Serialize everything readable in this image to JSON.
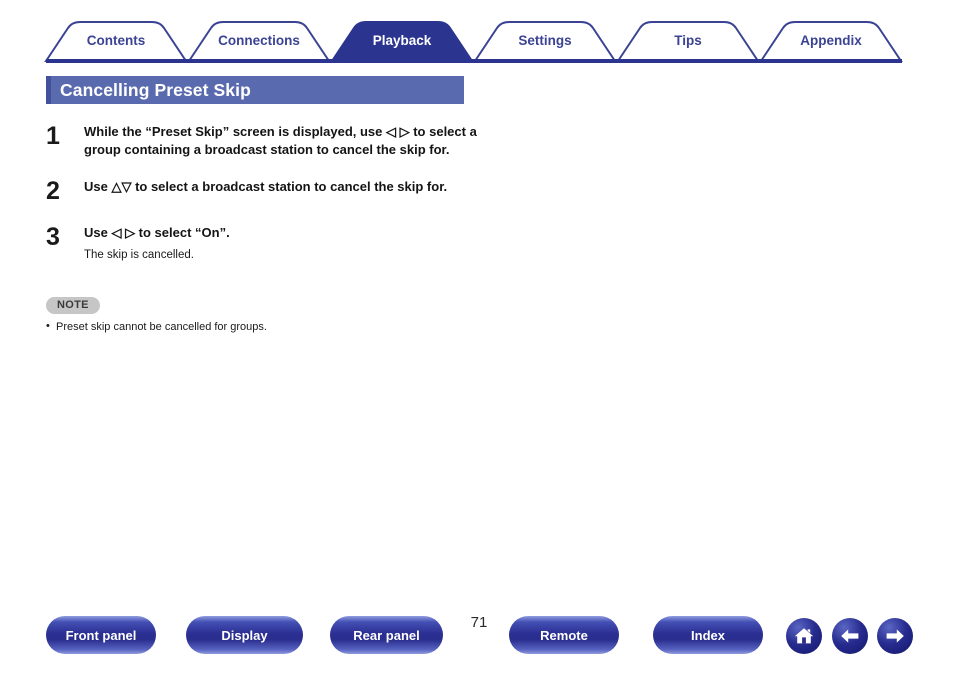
{
  "nav": {
    "tabs": [
      {
        "label": "Contents",
        "active": false
      },
      {
        "label": "Connections",
        "active": false
      },
      {
        "label": "Playback",
        "active": true
      },
      {
        "label": "Settings",
        "active": false
      },
      {
        "label": "Tips",
        "active": false
      },
      {
        "label": "Appendix",
        "active": false
      }
    ],
    "active_tab": "Playback",
    "accent_color": "#3b4394",
    "active_fill": "#2b3590"
  },
  "page": {
    "title": "Cancelling Preset Skip",
    "title_bar_color": "#5a6aae",
    "number": "71"
  },
  "steps": [
    {
      "number": "1",
      "text": "While the “Preset Skip” screen is displayed, use ◁ ▷ to select a group containing a broadcast station to cancel the skip for.",
      "sub": ""
    },
    {
      "number": "2",
      "text": "Use △▽ to select a broadcast station to cancel the skip for.",
      "sub": ""
    },
    {
      "number": "3",
      "text": "Use ◁ ▷ to select “On”.",
      "sub": "The skip is cancelled."
    }
  ],
  "note": {
    "badge": "NOTE",
    "badge_color": "#c6c6c6",
    "items": [
      "Preset skip cannot be cancelled for groups."
    ]
  },
  "footer": {
    "buttons": [
      {
        "label": "Front panel"
      },
      {
        "label": "Display"
      },
      {
        "label": "Rear panel"
      },
      {
        "label": "Remote"
      },
      {
        "label": "Index"
      }
    ],
    "icons": [
      {
        "name": "home-icon"
      },
      {
        "name": "arrow-left-icon"
      },
      {
        "name": "arrow-right-icon"
      }
    ],
    "button_color": "#2b2f93"
  }
}
